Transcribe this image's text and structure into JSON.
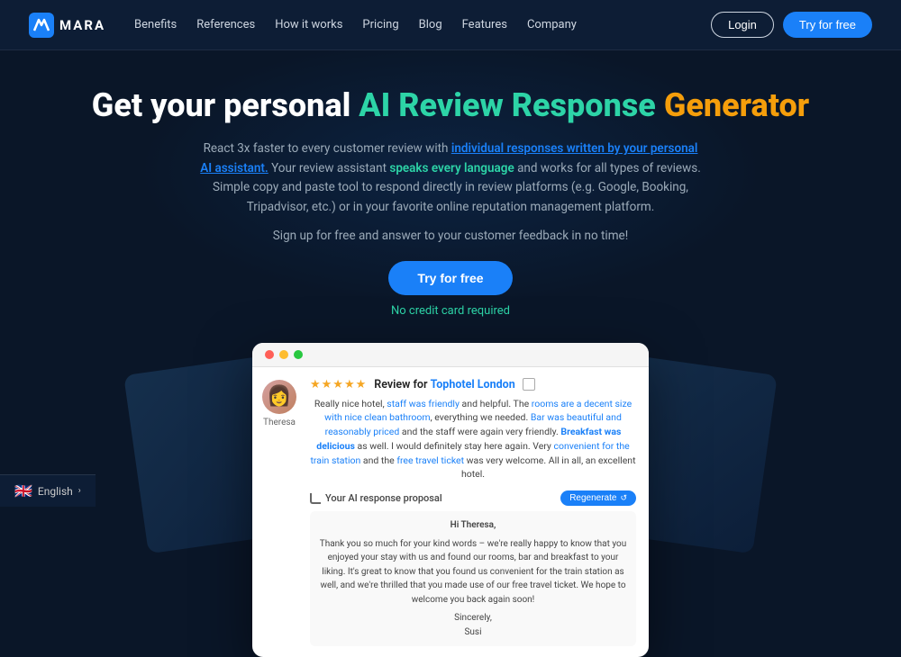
{
  "navbar": {
    "logo_text": "MARA",
    "links": [
      "Benefits",
      "References",
      "How it works",
      "Pricing",
      "Blog",
      "Features",
      "Company"
    ],
    "btn_login": "Login",
    "btn_try": "Try for free"
  },
  "hero": {
    "title_prefix": "Get your personal ",
    "title_ai": "AI Review Response",
    "title_suffix": " ",
    "title_generator": "Generator",
    "desc_prefix": "React 3x faster to every customer review with ",
    "desc_highlight1": "individual responses written by your personal AI assistant.",
    "desc_mid": " Your review assistant ",
    "desc_highlight2": "speaks every language",
    "desc_suffix": " and works for all types of reviews. Simple copy and paste tool to respond directly in review platforms (e.g. Google, Booking, Tripadvisor, etc.) or in your favorite online reputation management platform.",
    "tagline": "Sign up for free and answer to your customer feedback in no time!",
    "btn_try": "Try for free",
    "no_credit": "No credit card required"
  },
  "demo": {
    "reviewer_name": "Theresa",
    "stars": "★★★★★",
    "review_header": "Review for ",
    "hotel_name": "Tophotel London",
    "review_text_1": "Really nice hotel, ",
    "review_hl1": "staff was friendly",
    "review_text_2": " and helpful. The ",
    "review_hl2": "rooms are a decent size with nice clean bathroom",
    "review_text_3": ", everything we needed. ",
    "review_hl3": "Bar was beautiful and reasonably priced",
    "review_text_4": " and the staff were again very friendly. ",
    "review_hl4": "Breakfast was delicious",
    "review_text_5": " as well. I would definitely stay here again. Very ",
    "review_hl5": "convenient for the train station",
    "review_text_6": " and the ",
    "review_hl6": "free travel ticket",
    "review_text_7": " was very welcome. All in all, an excellent hotel.",
    "ai_label": "Your AI response proposal",
    "btn_regenerate": "Regenerate",
    "response_line1": "Hi Theresa,",
    "response_line2": "Thank you so much for your kind words – we're really happy to know that you enjoyed your stay with us and found our rooms, bar and breakfast to your liking. It's great to know that you found us convenient for the train station as well, and we're thrilled that you made use of our free travel ticket. We hope to welcome you back again soon!",
    "response_line3": "Sincerely,",
    "response_line4": "Susi"
  },
  "language_bar": {
    "flag": "🇬🇧",
    "lang": "English"
  }
}
